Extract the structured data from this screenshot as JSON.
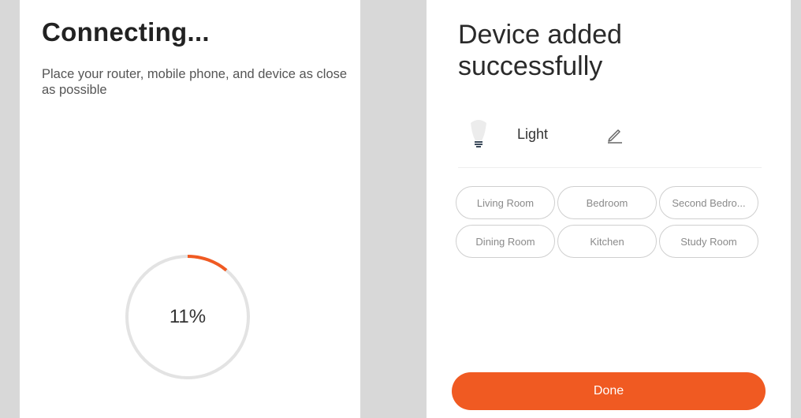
{
  "colors": {
    "accent": "#f05a22",
    "progress_track": "#e3e3e3",
    "gutter": "#d8d8d8"
  },
  "connecting": {
    "title": "Connecting...",
    "hint": "Place your router, mobile phone, and device as close as possible",
    "progress_label": "11%",
    "progress_fraction": 0.11
  },
  "success": {
    "title_line1": "Device added",
    "title_line2": "successfully",
    "device": {
      "icon": "lightbulb-icon",
      "name": "Light",
      "edit_icon": "pencil-icon"
    },
    "rooms": [
      {
        "label": "Living Room"
      },
      {
        "label": "Bedroom"
      },
      {
        "label": "Second Bedro..."
      },
      {
        "label": "Dining Room"
      },
      {
        "label": "Kitchen"
      },
      {
        "label": "Study Room"
      }
    ],
    "done_label": "Done"
  }
}
